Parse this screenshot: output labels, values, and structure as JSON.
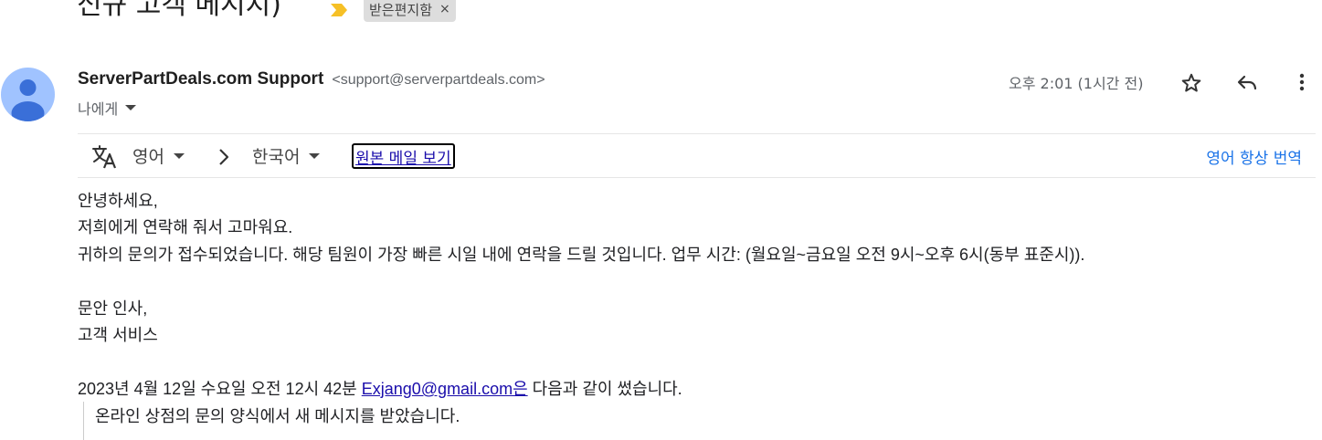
{
  "subject": {
    "title": "신규 고객 메시지)",
    "label": "받은편지함",
    "label_close": "×"
  },
  "sender": {
    "name": "ServerPartDeals.com Support",
    "email": "<support@serverpartdeals.com>",
    "to": "나에게",
    "time": "오후 2:01 (1시간 전)"
  },
  "translate": {
    "from_lang": "영어",
    "to_lang": "한국어",
    "view_original": "원본 메일 보기",
    "always_translate": "영어 항상 번역"
  },
  "body": {
    "lines": [
      "안녕하세요,",
      "저희에게 연락해 줘서 고마워요.",
      "귀하의 문의가 접수되었습니다. 해당 팀원이 가장 빠른 시일 내에 연락을 드릴 것입니다. 업무 시간: (월요일~금요일 오전 9시~오후 6시(동부 표준시)).",
      "문안 인사,",
      "고객 서비스"
    ],
    "quote_header_prefix": "2023년 4월 12일 수요일 오전 12시 42분 ",
    "quote_link": "Exjang0@gmail.com은",
    "quote_header_suffix": " 다음과 같이 썼습니다.",
    "quoted": "온라인 상점의 문의 양식에서 새 메시지를 받았습니다."
  },
  "colors": {
    "avatar_bg": "#a0c3ff",
    "importance": "#f6c026",
    "link": "#1a0dab",
    "accent": "#1a73e8"
  },
  "icons": [
    "importance-marker-icon",
    "person-icon",
    "star-icon",
    "reply-icon",
    "more-vert-icon",
    "translate-icon",
    "chevron-right-icon"
  ]
}
